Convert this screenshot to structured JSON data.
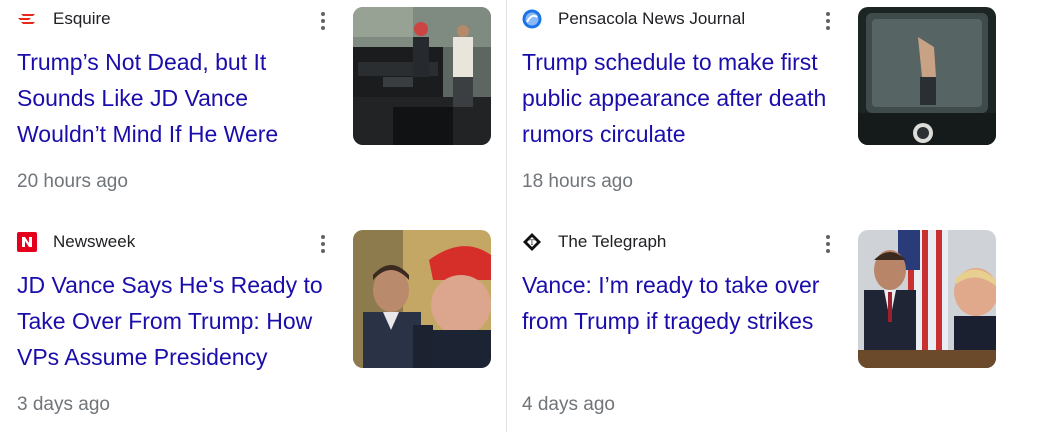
{
  "articles": [
    {
      "source": "Esquire",
      "source_icon": "esquire-logo-icon",
      "headline": "Trump’s Not Dead, but It Sounds Like JD Vance Wouldn’t Mind If He Were",
      "time": "20 hours ago"
    },
    {
      "source": "Pensacola News Journal",
      "source_icon": "pensacola-news-journal-logo-icon",
      "headline": "Trump schedule to make first public appearance after death rumors circulate",
      "time": "18 hours ago"
    },
    {
      "source": "Newsweek",
      "source_icon": "newsweek-logo-icon",
      "headline": "JD Vance Says He's Ready to Take Over From Trump: How VPs Assume Presidency",
      "time": "3 days ago"
    },
    {
      "source": "The Telegraph",
      "source_icon": "telegraph-logo-icon",
      "headline": "Vance: I’m ready to take over from Trump if tragedy strikes",
      "time": "4 days ago"
    }
  ],
  "colors": {
    "headline": "#1a0dab",
    "meta": "#70757a",
    "source": "#202124",
    "esquire_red": "#e8291c",
    "newsweek_red": "#e4001b",
    "pnj_blue": "#1a73e8"
  }
}
